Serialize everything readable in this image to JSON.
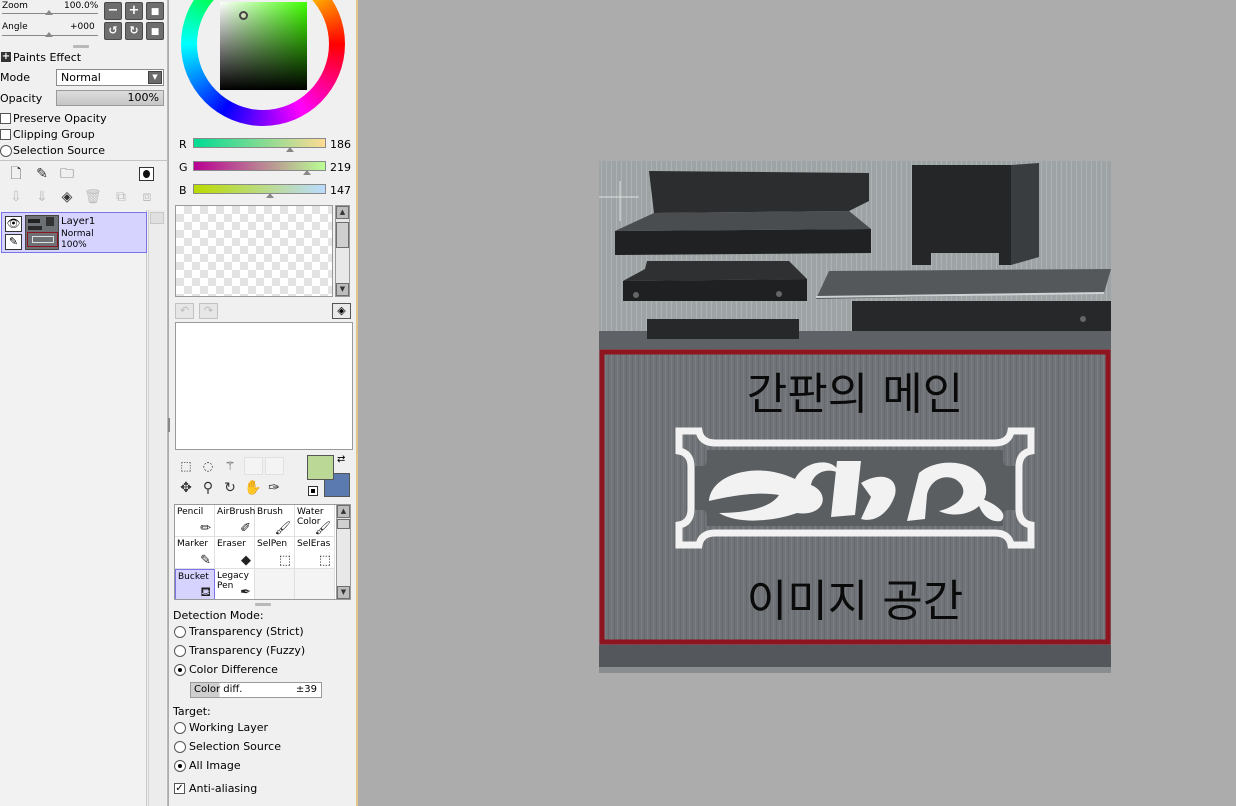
{
  "navigator": {
    "zoom_label": "Zoom",
    "zoom_value": "100.0%",
    "angle_label": "Angle",
    "angle_value": "+000",
    "buttons": [
      "zoom-out",
      "zoom-in",
      "reset-zoom",
      "rotate-left",
      "rotate-right",
      "reset-rotation"
    ]
  },
  "layer_props": {
    "paints_effect_label": "Paints Effect",
    "mode_label": "Mode",
    "mode_value": "Normal",
    "opacity_label": "Opacity",
    "opacity_value": "100%",
    "preserve_opacity_label": "Preserve Opacity",
    "clipping_group_label": "Clipping Group",
    "selection_source_label": "Selection Source"
  },
  "layers": [
    {
      "name": "Layer1",
      "mode": "Normal",
      "opacity": "100%"
    }
  ],
  "color": {
    "r_label": "R",
    "r_value": "186",
    "g_label": "G",
    "g_value": "219",
    "b_label": "B",
    "b_value": "147",
    "r_fraction": 0.729,
    "g_fraction": 0.859,
    "b_fraction": 0.576,
    "foreground": "#bcd896",
    "background": "#5a7ab0"
  },
  "brushes": [
    {
      "label": "Pencil",
      "icon": "pencil-icon"
    },
    {
      "label": "AirBrush",
      "icon": "airbrush-icon"
    },
    {
      "label": "Brush",
      "icon": "brush-icon"
    },
    {
      "label": "Water Color",
      "icon": "watercolor-icon"
    },
    {
      "label": "Marker",
      "icon": "marker-icon"
    },
    {
      "label": "Eraser",
      "icon": "eraser-icon"
    },
    {
      "label": "SelPen",
      "icon": "selpen-icon"
    },
    {
      "label": "SelEras",
      "icon": "seleras-icon"
    },
    {
      "label": "Bucket",
      "icon": "bucket-icon"
    },
    {
      "label": "Legacy Pen",
      "icon": "legacy-pen-icon"
    }
  ],
  "bucket_options": {
    "detection_mode_label": "Detection Mode:",
    "detection_modes": [
      "Transparency (Strict)",
      "Transparency (Fuzzy)",
      "Color Difference"
    ],
    "detection_selected": "Color Difference",
    "color_diff_label": "Color diff.",
    "color_diff_value": "±39",
    "target_label": "Target:",
    "targets": [
      "Working Layer",
      "Selection Source",
      "All Image"
    ],
    "target_selected": "All Image",
    "anti_aliasing_label": "Anti-aliasing",
    "anti_aliasing": true
  },
  "canvas": {
    "sign_top_text": "간판의 메인",
    "sign_bottom_text": "이미지 공간",
    "sign_border_color": "#8e1420"
  }
}
